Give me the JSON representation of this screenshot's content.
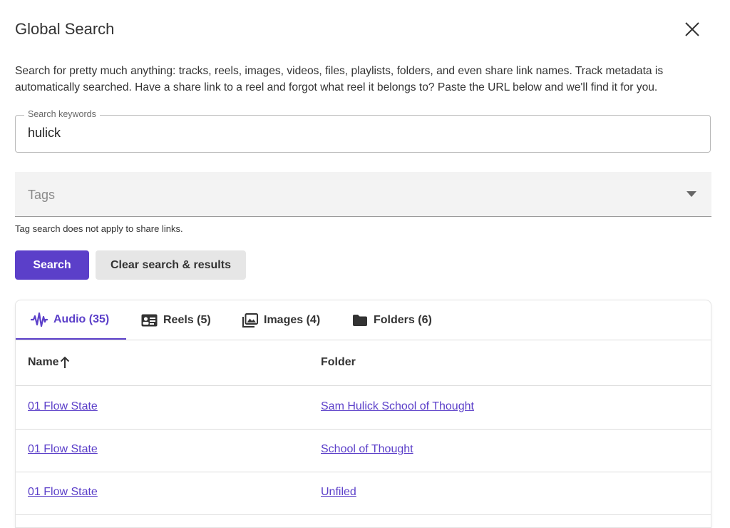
{
  "dialog": {
    "title": "Global Search",
    "description": "Search for pretty much anything: tracks, reels, images, videos, files, playlists, folders, and even share link names. Track metadata is automatically searched. Have a share link to a reel and forgot what reel it belongs to? Paste the URL below and we'll find it for you."
  },
  "search": {
    "keywords_label": "Search keywords",
    "keywords_value": "hulick",
    "tags_placeholder": "Tags",
    "tags_helper": "Tag search does not apply to share links.",
    "search_button": "Search",
    "clear_button": "Clear search & results"
  },
  "tabs": [
    {
      "label": "Audio (35)",
      "icon": "waveform-icon",
      "active": true
    },
    {
      "label": "Reels (5)",
      "icon": "reel-card-icon",
      "active": false
    },
    {
      "label": "Images (4)",
      "icon": "images-icon",
      "active": false
    },
    {
      "label": "Folders (6)",
      "icon": "folder-icon",
      "active": false
    }
  ],
  "table": {
    "columns": [
      "Name",
      "Folder"
    ],
    "sort": {
      "column": "Name",
      "direction": "ascending"
    },
    "rows": [
      {
        "name": "01 Flow State",
        "folder": "Sam Hulick School of Thought"
      },
      {
        "name": "01 Flow State",
        "folder": "School of Thought"
      },
      {
        "name": "01 Flow State",
        "folder": "Unfiled"
      }
    ]
  },
  "colors": {
    "accent": "#5b3fc9",
    "clear_button_bg": "#e6e6e6",
    "tags_bg": "#f3f3f3"
  }
}
